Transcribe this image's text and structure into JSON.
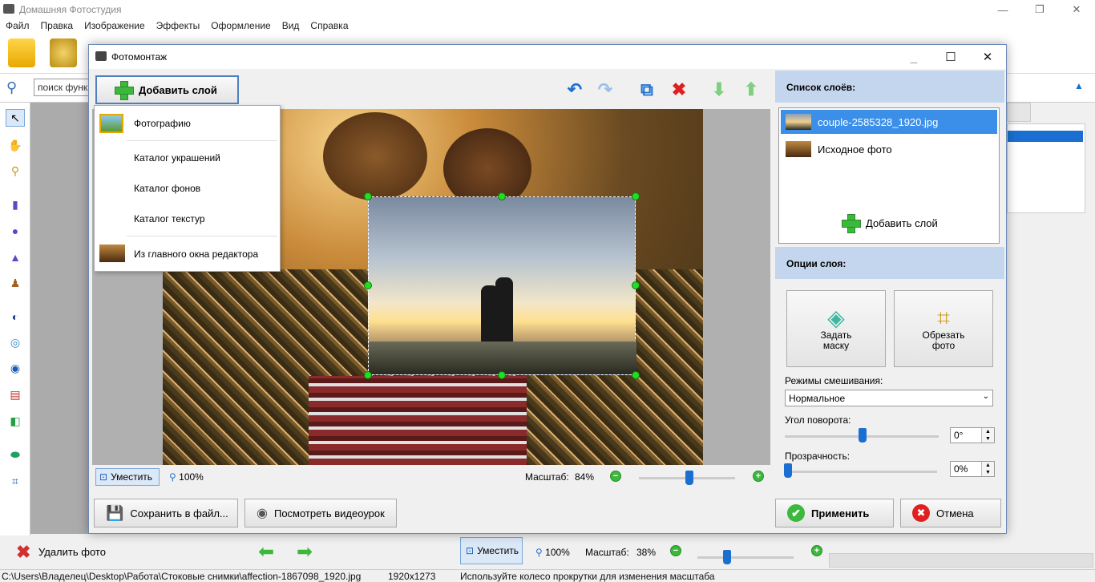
{
  "app": {
    "title": "Домашняя Фотостудия",
    "menu": [
      "Файл",
      "Правка",
      "Изображение",
      "Эффекты",
      "Оформление",
      "Вид",
      "Справка"
    ],
    "search_placeholder": "поиск функ",
    "bottom": {
      "delete_label": "Удалить фото",
      "fit_label": "Уместить",
      "zoom_100": "100%",
      "scale_label": "Масштаб:",
      "scale_value": "38%",
      "scale_fraction": 0.38
    },
    "status": {
      "path": "C:\\Users\\Владелец\\Desktop\\Работа\\Стоковые снимки\\affection-1867098_1920.jpg",
      "dimensions": "1920x1273",
      "hint": "Используйте колесо прокрутки для изменения масштаба"
    }
  },
  "dialog": {
    "title": "Фотомонтаж",
    "add_layer_label": "Добавить слой",
    "dropdown": {
      "items": [
        {
          "label": "Фотографию"
        },
        {
          "label": "Каталог украшений"
        },
        {
          "label": "Каталог фонов"
        },
        {
          "label": "Каталог текстур"
        },
        {
          "label": "Из главного окна редактора"
        }
      ]
    },
    "zoom": {
      "fit_label": "Уместить",
      "zoom_100": "100%",
      "scale_label": "Масштаб:",
      "scale_value": "84%",
      "scale_fraction": 0.84
    },
    "layers": {
      "header": "Список слоёв:",
      "items": [
        {
          "label": "couple-2585328_1920.jpg",
          "selected": true
        },
        {
          "label": "Исходное фото",
          "selected": false
        }
      ],
      "add_label": "Добавить слой"
    },
    "options": {
      "header": "Опции слоя:",
      "mask_label_1": "Задать",
      "mask_label_2": "маску",
      "crop_label_1": "Обрезать",
      "crop_label_2": "фото",
      "blend_label": "Режимы смешивания:",
      "blend_value": "Нормальное",
      "rotation_label": "Угол поворота:",
      "rotation_value": "0°",
      "opacity_label": "Прозрачность:",
      "opacity_value": "0%"
    },
    "buttons": {
      "save": "Сохранить в файл...",
      "video": "Посмотреть видеоурок",
      "apply": "Применить",
      "cancel": "Отмена"
    }
  },
  "colors": {
    "accent": "#1a6fd0",
    "selection": "#3b8fe8",
    "section": "#c4d6ee",
    "handle": "#22dd22"
  }
}
